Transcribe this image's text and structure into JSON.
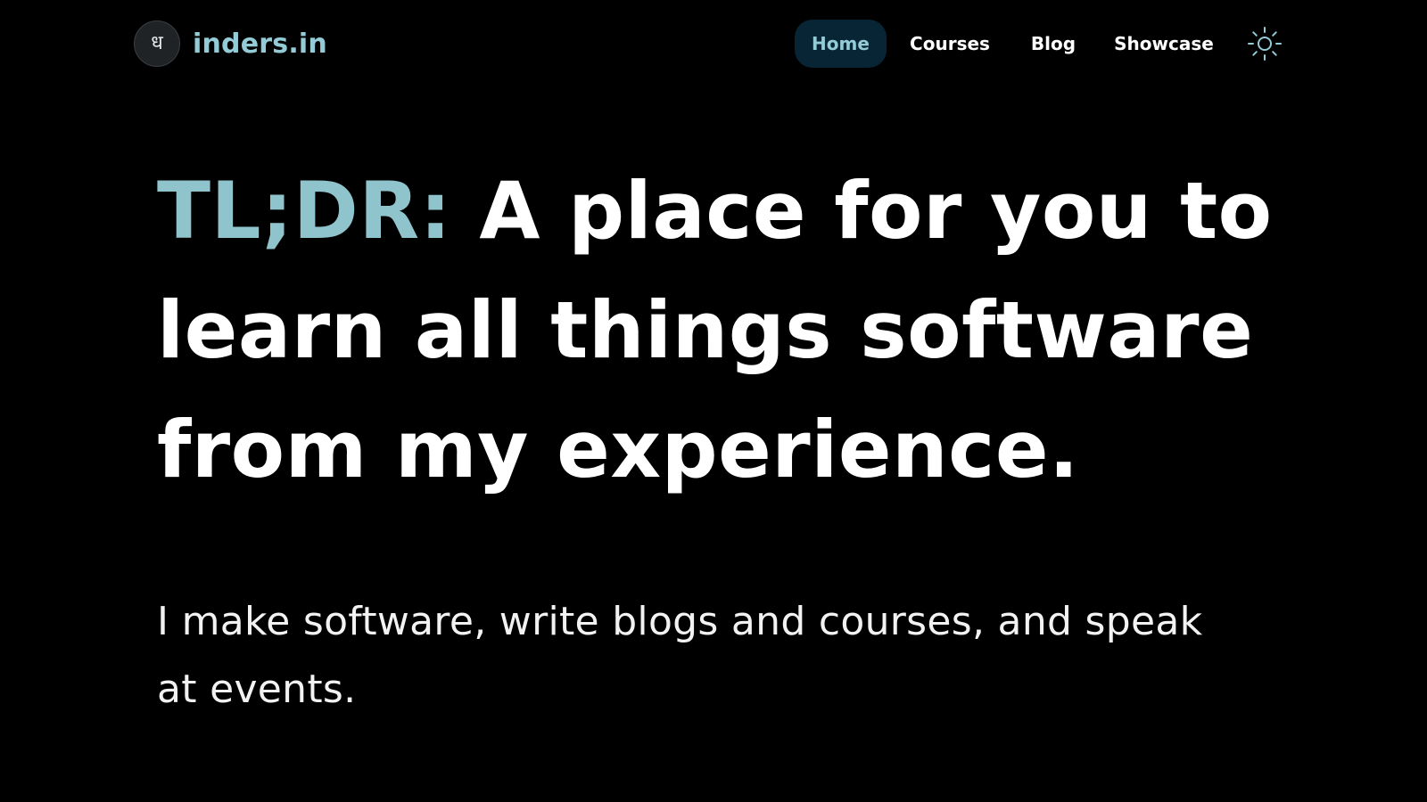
{
  "brand": {
    "logo_glyph": "ध",
    "name": "inders.in"
  },
  "nav": {
    "items": [
      {
        "label": "Home",
        "active": true
      },
      {
        "label": "Courses",
        "active": false
      },
      {
        "label": "Blog",
        "active": false
      },
      {
        "label": "Showcase",
        "active": false
      }
    ],
    "theme_toggle_icon": "sun-icon"
  },
  "hero": {
    "accent": "TL;DR:",
    "title": " A place for you to learn all things software from my experience.",
    "subtitle": "I make software, write blogs and courses, and speak at events."
  },
  "colors": {
    "background": "#000000",
    "accent": "#93cbd7",
    "active_nav_bg": "#082535",
    "text": "#ffffff"
  }
}
